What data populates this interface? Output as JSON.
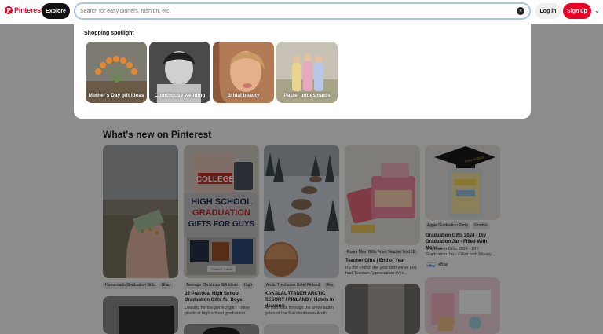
{
  "header": {
    "logo_text": "Pinterest",
    "logo_glyph": "P",
    "explore_label": "Explore",
    "search_placeholder": "Search for easy dinners, fashion, etc.",
    "clear_glyph": "×",
    "login_label": "Log in",
    "signup_label": "Sign up",
    "more_glyph": "⌄"
  },
  "spotlight": {
    "title": "Shopping spotlight",
    "items": [
      {
        "label": "Mother's Day gift ideas"
      },
      {
        "label": "Courthouse wedding"
      },
      {
        "label": "Bridal beauty"
      },
      {
        "label": "Pastel bridesmaids"
      }
    ]
  },
  "main": {
    "title": "What's new on Pinterest",
    "pins": [
      {
        "chips": [
          "Homemade Graduation Gifts",
          "Grad"
        ]
      },
      {
        "chips": [
          "Teenage Christmas Gift Ideas",
          "High"
        ],
        "title": "35 Practical High School Graduation Gifts for Boys",
        "desc": "Looking for the perfect gift? These practical high school graduation...",
        "image_text": {
          "top": "COLLEGE",
          "l1": "HIGH SCHOOL",
          "l2": "GRADUATION",
          "l3": "GIFTS FOR GUYS",
          "credit": "CHARM DARS"
        }
      },
      {
        "chips": [
          "Arctic Treehouse Hotel Finland",
          "Ros"
        ],
        "title": "KAKSLAUTTANEN ARCTIC RESORT / FINLAND // Hotels in Heaven®",
        "desc": "As you walk through the snow laden gates of the Kakslauttanen Arctic..."
      },
      {
        "chips": [
          "Room Mom Gifts From Teacher End Of"
        ],
        "title": "Teacher Gifts | End of Year",
        "desc": "It's the end of the year and we've just had Teacher Appreciation Wee..."
      },
      {
        "chips": [
          "Aggie Graduation Party",
          "Gradua"
        ],
        "title": "Graduation Gifts 2024 - Diy Graduation Jar - Filled With Mone...",
        "desc": "Graduation Gifts 2024 - DIY Graduation Jar - Filled with Money ...",
        "seller": "eBay",
        "seller_badge": "eBay",
        "cap_text": "Class of 2024"
      }
    ]
  }
}
